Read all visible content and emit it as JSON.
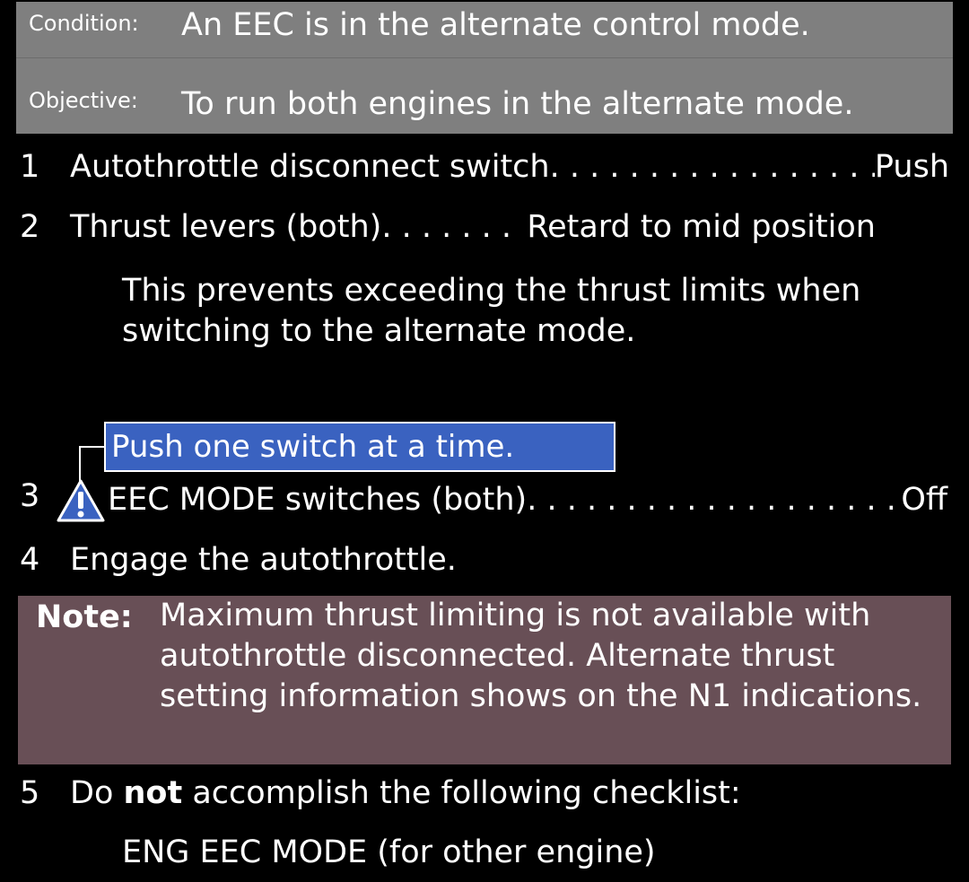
{
  "header": {
    "condition_label": "Condition:",
    "condition_text": "An EEC is in the alternate control mode.",
    "objective_label": "Objective:",
    "objective_text": "To run both engines in the alternate mode."
  },
  "steps": [
    {
      "number": "1",
      "item": "Autothrottle disconnect switch",
      "action": "Push"
    },
    {
      "number": "2",
      "item": "Thrust levers (both)",
      "action": "Retard to mid position",
      "explanation": "This prevents exceeding the thrust limits when switching to the alternate mode."
    },
    {
      "number": "3",
      "caution": "Push one switch at a time.",
      "item": "EEC MODE switches (both)",
      "action": "Off"
    },
    {
      "number": "4",
      "text": "Engage the autothrottle."
    },
    {
      "number": "5",
      "text_before": "Do ",
      "text_bold": "not",
      "text_after": " accomplish the following checklist:",
      "checklist": "ENG EEC MODE (for other engine)"
    }
  ],
  "note": {
    "label": "Note:",
    "text": "Maximum thrust limiting is not available with autothrottle disconnected. Alternate thrust setting information shows on the N1 indications."
  },
  "colors": {
    "background": "#000000",
    "header_bg": "#7f7f7f",
    "caution_bg": "#3a62c0",
    "note_bg": "#684f56",
    "text": "#ffffff"
  },
  "icons": {
    "caution": "caution-triangle-icon"
  }
}
